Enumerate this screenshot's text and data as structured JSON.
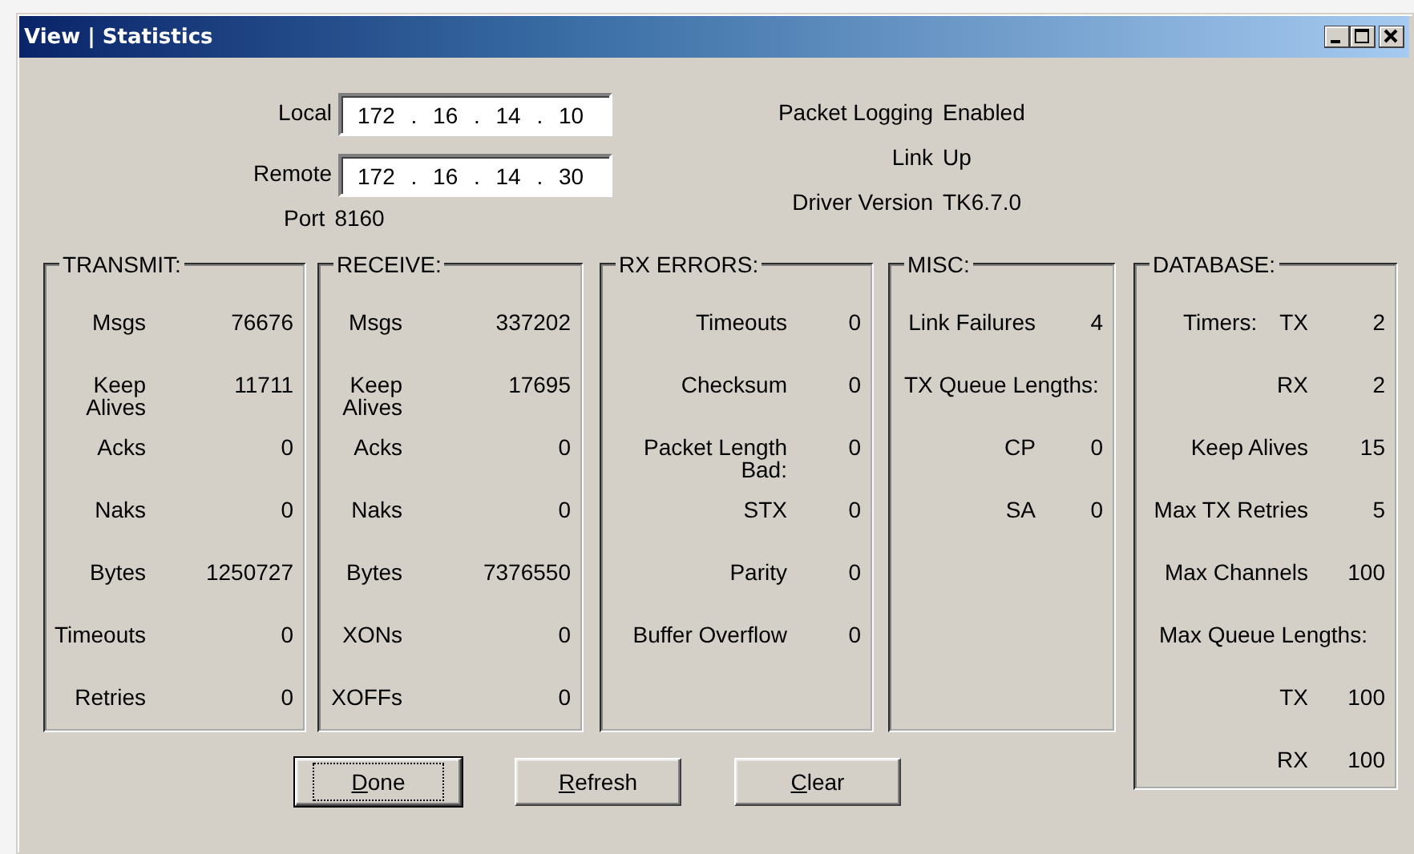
{
  "window": {
    "title": "View | Statistics"
  },
  "connection": {
    "fields": [
      {
        "label": "Local",
        "value": "172 . 16 . 14 . 10"
      },
      {
        "label": "Remote",
        "value": "172 . 16 . 14 . 30"
      }
    ],
    "port": {
      "label": "Port",
      "value": "8160"
    }
  },
  "info": [
    {
      "label": "Packet Logging",
      "value": "Enabled"
    },
    {
      "label": "Link",
      "value": "Up"
    },
    {
      "label": "Driver Version",
      "value": "TK6.7.0"
    }
  ],
  "groups": [
    {
      "title": "TRANSMIT:",
      "rows": [
        {
          "label": "Msgs",
          "value": "76676"
        },
        {
          "label": "Keep Alives",
          "value": "11711"
        },
        {
          "label": "Acks",
          "value": "0"
        },
        {
          "label": "Naks",
          "value": "0"
        },
        {
          "label": "Bytes",
          "value": "1250727"
        },
        {
          "label": "Timeouts",
          "value": "0"
        },
        {
          "label": "Retries",
          "value": "0"
        }
      ]
    },
    {
      "title": "RECEIVE:",
      "rows": [
        {
          "label": "Msgs",
          "value": "337202"
        },
        {
          "label": "Keep Alives",
          "value": "17695"
        },
        {
          "label": "Acks",
          "value": "0"
        },
        {
          "label": "Naks",
          "value": "0"
        },
        {
          "label": "Bytes",
          "value": "7376550"
        },
        {
          "label": "XONs",
          "value": "0"
        },
        {
          "label": "XOFFs",
          "value": "0"
        }
      ]
    },
    {
      "title": "RX ERRORS:",
      "rows": [
        {
          "label": "Timeouts",
          "value": "0"
        },
        {
          "label": "Checksum",
          "value": "0"
        },
        {
          "label": "Packet Length Bad:",
          "value": "0"
        },
        {
          "label": "STX",
          "value": "0"
        },
        {
          "label": "Parity",
          "value": "0"
        },
        {
          "label": "Buffer Overflow",
          "value": "0"
        }
      ]
    },
    {
      "title": "MISC:",
      "rows": [
        {
          "label": "Link Failures",
          "value": "4"
        },
        {
          "kind": "heading",
          "label": "TX Queue Lengths:"
        },
        {
          "label": "CP",
          "value": "0"
        },
        {
          "label": "SA",
          "value": "0"
        }
      ]
    },
    {
      "title": "DATABASE:",
      "rows": [
        {
          "prefix": "Timers:",
          "label": "TX",
          "value": "2"
        },
        {
          "label": "RX",
          "value": "2"
        },
        {
          "label": "Keep Alives",
          "value": "15"
        },
        {
          "label": "Max TX Retries",
          "value": "5"
        },
        {
          "label": "Max Channels",
          "value": "100"
        },
        {
          "kind": "heading",
          "label": "Max Queue Lengths:"
        },
        {
          "label": "TX",
          "value": "100"
        },
        {
          "label": "RX",
          "value": "100"
        }
      ]
    }
  ],
  "buttons": [
    {
      "label": "Done",
      "underline_first": true,
      "default": true
    },
    {
      "label": "Refresh",
      "underline_first": true,
      "default": false
    },
    {
      "label": "Clear",
      "underline_first": true,
      "default": false
    }
  ]
}
